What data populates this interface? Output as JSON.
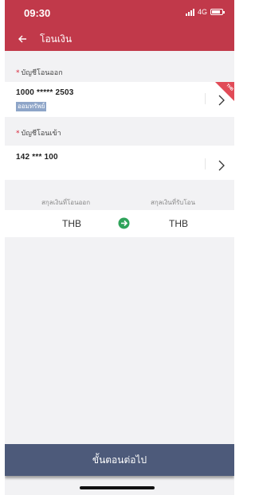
{
  "status_bar": {
    "time": "09:30",
    "network": "4G"
  },
  "header": {
    "title": "โอนเงิน"
  },
  "from_account": {
    "label": "บัญชีโอนออก",
    "required_mark": "*",
    "number": "1000  *****  2503",
    "type": "ออมทรัพย์",
    "badge": "THB"
  },
  "to_account": {
    "label": "บัญชีโอนเข้า",
    "required_mark": "*",
    "number": "142 *** 100"
  },
  "currency": {
    "from_label": "สกุลเงินที่โอนออก",
    "to_label": "สกุลเงินที่รับโอน",
    "from_value": "THB",
    "to_value": "THB"
  },
  "next_button": {
    "label": "ขั้นตอนต่อไป"
  },
  "colors": {
    "header": "#c1394a",
    "button": "#4d5a7a",
    "swap": "#2fa35a",
    "required": "#d9263a"
  }
}
